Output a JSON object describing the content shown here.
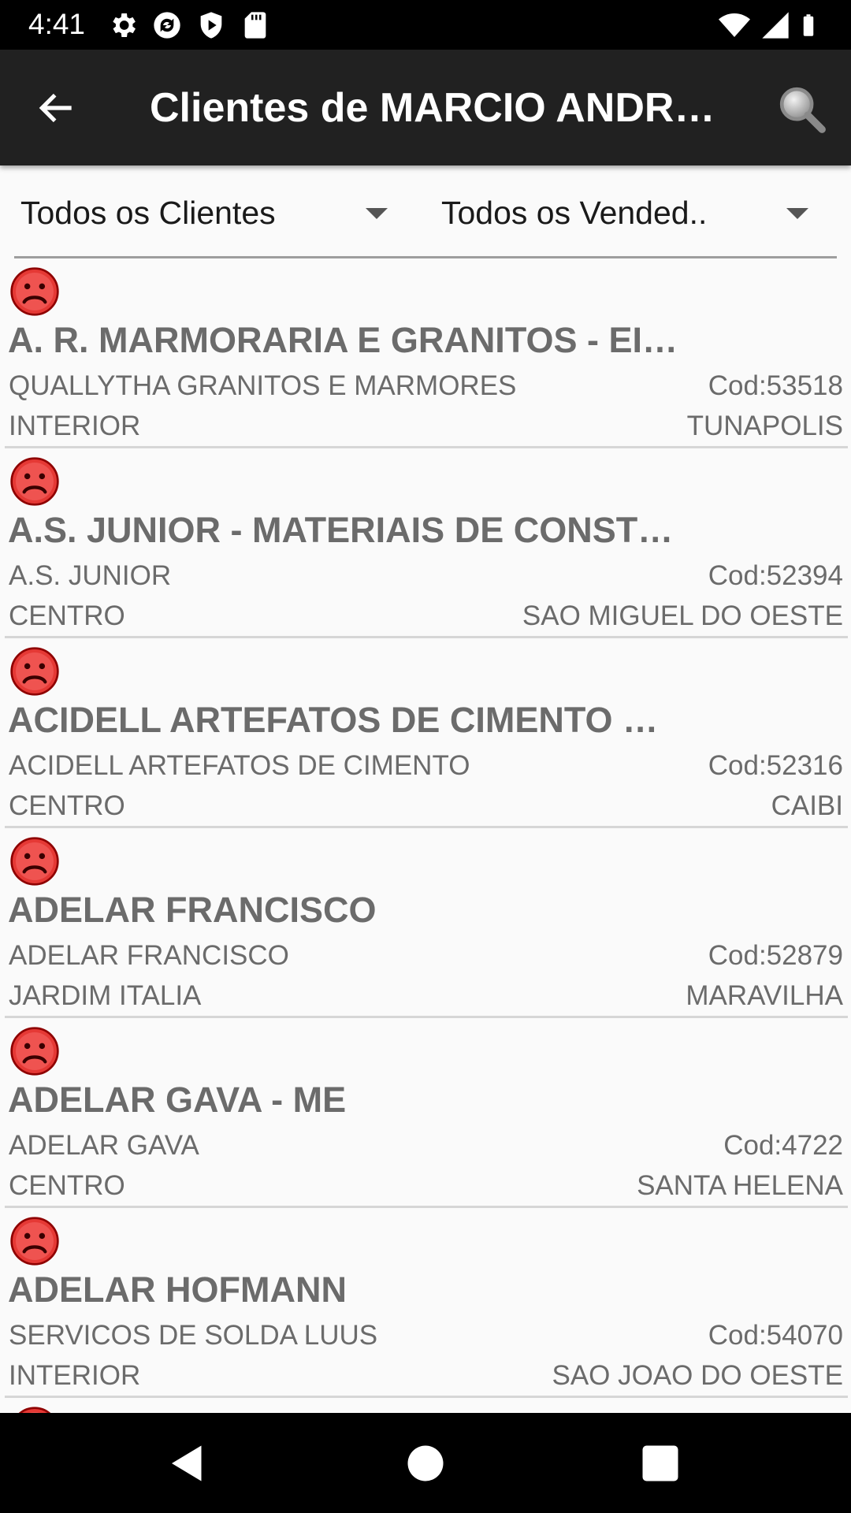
{
  "status_bar": {
    "time": "4:41",
    "left_icons": [
      "settings-icon",
      "sync-icon",
      "shield-icon",
      "sd-card-icon"
    ],
    "right_icons": [
      "wifi-icon",
      "signal-icon",
      "battery-icon"
    ]
  },
  "app_bar": {
    "title": "Clientes de MARCIO ANDRE…",
    "back_icon": "arrow-back-icon",
    "search_icon": "search-icon"
  },
  "filters": {
    "clients_filter": "Todos os Clientes",
    "sellers_filter": "Todos os Vended.."
  },
  "clients": [
    {
      "name": "A. R. MARMORARIA E GRANITOS - EI…",
      "fantasy": "QUALLYTHA GRANITOS E MARMORES",
      "cod": "Cod:53518",
      "bairro": "INTERIOR",
      "city": "TUNAPOLIS"
    },
    {
      "name": "A.S. JUNIOR - MATERIAIS DE CONST…",
      "fantasy": "A.S. JUNIOR",
      "cod": "Cod:52394",
      "bairro": "CENTRO",
      "city": "SAO MIGUEL DO OESTE"
    },
    {
      "name": "ACIDELL ARTEFATOS DE CIMENTO DE…",
      "fantasy": "ACIDELL ARTEFATOS DE CIMENTO",
      "cod": "Cod:52316",
      "bairro": "CENTRO",
      "city": "CAIBI"
    },
    {
      "name": "ADELAR FRANCISCO",
      "fantasy": "ADELAR FRANCISCO",
      "cod": "Cod:52879",
      "bairro": "JARDIM ITALIA",
      "city": "MARAVILHA"
    },
    {
      "name": "ADELAR GAVA - ME",
      "fantasy": "ADELAR GAVA",
      "cod": "Cod:4722",
      "bairro": "CENTRO",
      "city": "SANTA HELENA"
    },
    {
      "name": "ADELAR HOFMANN",
      "fantasy": "SERVICOS DE SOLDA LUUS",
      "cod": "Cod:54070",
      "bairro": "INTERIOR",
      "city": "SAO JOAO DO OESTE"
    }
  ],
  "colors": {
    "status_icon": "#d32f2f",
    "app_bar": "#212121",
    "text_secondary": "#6b6b6b"
  },
  "nav_bar": {
    "icons": [
      "nav-back-icon",
      "nav-home-icon",
      "nav-recents-icon"
    ]
  }
}
